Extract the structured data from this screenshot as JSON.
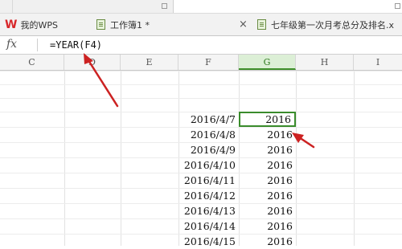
{
  "tabs": [
    {
      "label": "我的WPS"
    },
    {
      "label": "工作簿1 *"
    },
    {
      "label": "七年级第一次月考总分及排名.x"
    }
  ],
  "close_glyph": "×",
  "formula_bar": {
    "fx_label": "fx",
    "formula": "=YEAR(F4)"
  },
  "columns": [
    "C",
    "D",
    "E",
    "F",
    "G",
    "H",
    "I"
  ],
  "active_column": "G",
  "rows": [
    {
      "date": "2016/4/7",
      "year": "2016"
    },
    {
      "date": "2016/4/8",
      "year": "2016"
    },
    {
      "date": "2016/4/9",
      "year": "2016"
    },
    {
      "date": "2016/4/10",
      "year": "2016"
    },
    {
      "date": "2016/4/11",
      "year": "2016"
    },
    {
      "date": "2016/4/12",
      "year": "2016"
    },
    {
      "date": "2016/4/13",
      "year": "2016"
    },
    {
      "date": "2016/4/14",
      "year": "2016"
    },
    {
      "date": "2016/4/15",
      "year": "2016"
    }
  ],
  "colors": {
    "annotation_arrow": "#cc2222",
    "selection": "#3a8c2c",
    "wps_red": "#d8282b"
  }
}
